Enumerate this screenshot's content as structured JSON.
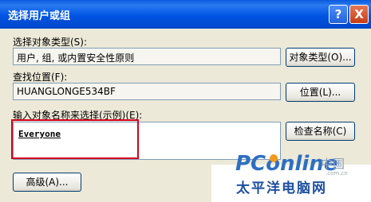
{
  "window": {
    "title": "选择用户或组",
    "help_glyph": "?",
    "close_glyph": "X"
  },
  "object_type": {
    "label": "选择对象类型(S):",
    "value": "用户, 组, 或内置安全性原则",
    "button": "对象类型(O)..."
  },
  "location": {
    "label": "查找位置(F):",
    "value": "HUANGLONGE534BF",
    "button": "位置(L)..."
  },
  "names": {
    "label": "输入对象名称来选择(示例)(E):",
    "entered": "Everyone",
    "check_button": "检查名称(C)"
  },
  "advanced_button": "高级(A)...",
  "watermark": {
    "brand": "PConline",
    "side": "中国",
    "url": ".com.cn",
    "chinese": "太平洋电脑网"
  },
  "colors": {
    "titlebar": "#0054e3",
    "dialog_bg": "#ece9d8",
    "highlight": "#d6001c",
    "brand": "#2f6fc2"
  }
}
